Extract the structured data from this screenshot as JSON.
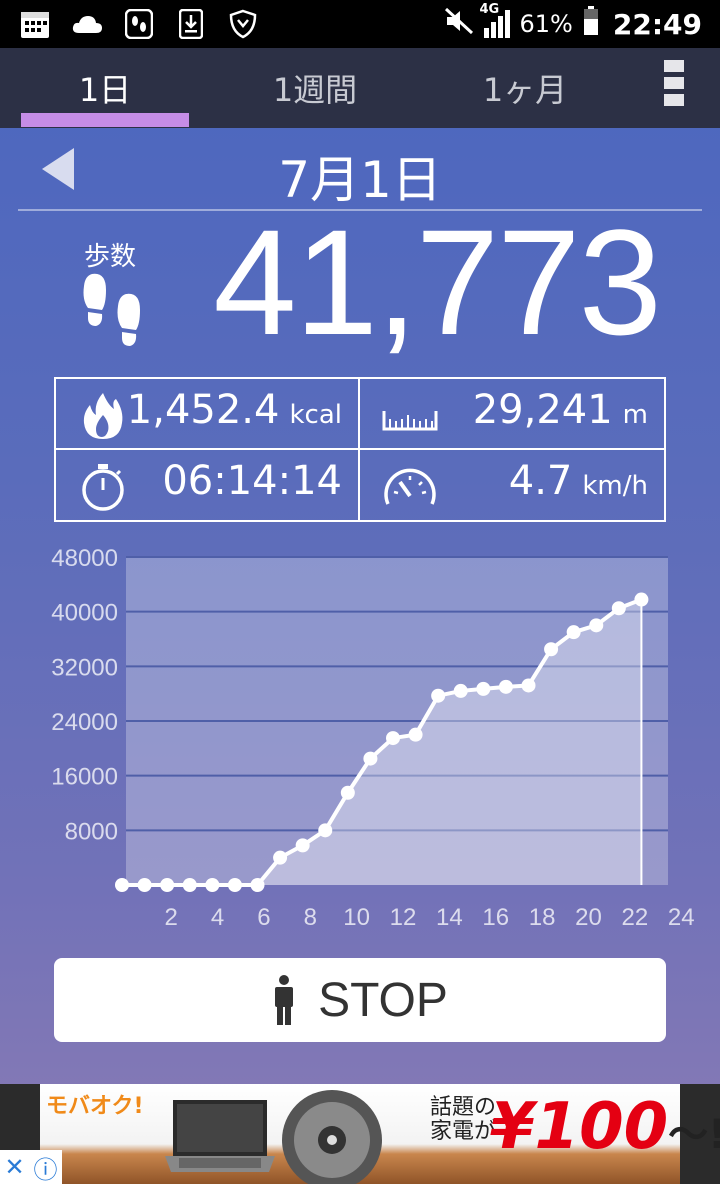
{
  "status_bar": {
    "network": "4G",
    "battery": "61%",
    "time": "22:49",
    "left_icons": [
      "calendar-icon",
      "cloud-icon",
      "footsteps-notification-icon",
      "download-icon",
      "shield-icon"
    ]
  },
  "tabs": [
    {
      "label": "1日",
      "active": true
    },
    {
      "label": "1週間",
      "active": false
    },
    {
      "label": "1ヶ月",
      "active": false
    }
  ],
  "date": "7月1日",
  "steps": {
    "label": "歩数",
    "value": "41,773"
  },
  "stats": {
    "calories": {
      "value": "1,452.4",
      "unit": "kcal"
    },
    "distance": {
      "value": "29,241",
      "unit": "m"
    },
    "duration": {
      "value": "06:14:14",
      "unit": ""
    },
    "speed": {
      "value": "4.7",
      "unit": "km/h"
    }
  },
  "chart_data": {
    "type": "area",
    "x": [
      0,
      1,
      2,
      3,
      4,
      5,
      6,
      7,
      8,
      9,
      10,
      11,
      12,
      13,
      14,
      15,
      16,
      17,
      18,
      19,
      20,
      21,
      22,
      23
    ],
    "values": [
      0,
      0,
      0,
      0,
      0,
      0,
      0,
      4000,
      5800,
      8000,
      13500,
      18500,
      21500,
      22000,
      27700,
      28400,
      28700,
      29000,
      29200,
      34500,
      37000,
      38000,
      40500,
      41773
    ],
    "ylim": [
      0,
      48000
    ],
    "xlim": [
      0,
      24
    ],
    "y_ticks": [
      "48000",
      "40000",
      "32000",
      "24000",
      "16000",
      "8000"
    ],
    "x_ticks": [
      "2",
      "4",
      "6",
      "8",
      "10",
      "12",
      "14",
      "16",
      "18",
      "20",
      "22",
      "24"
    ],
    "grid": true
  },
  "stop_button": {
    "label": "STOP"
  },
  "ad": {
    "brand": "モバオク!",
    "line1": "話題の",
    "line2": "家電が",
    "price": "¥100",
    "suffix": "〜!?"
  }
}
